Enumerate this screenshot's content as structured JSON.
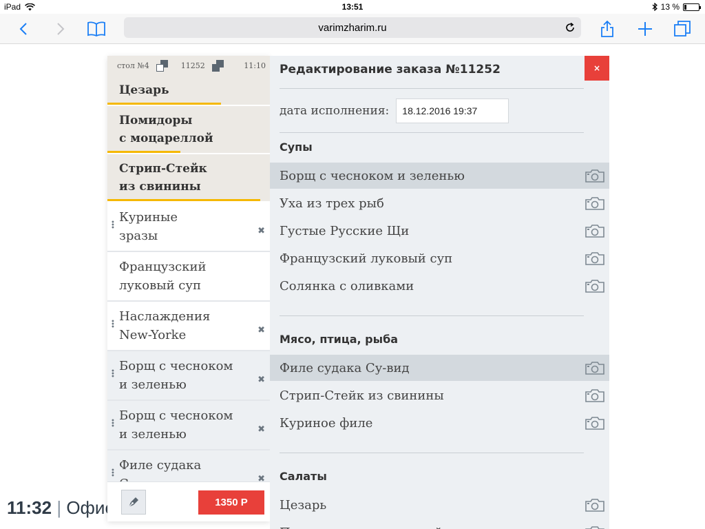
{
  "status_bar": {
    "device": "iPad",
    "time": "13:51",
    "battery_percent": "13 %",
    "battery_level": 0.13
  },
  "browser": {
    "url": "varimzharim.ru"
  },
  "background": {
    "clock": "11:32",
    "separator": "|",
    "partial_text": "Офис"
  },
  "order_panel": {
    "table": "стол №4",
    "order_number": "11252",
    "time": "11:10",
    "bold_dishes": [
      {
        "line1": "Цезарь",
        "line2": "",
        "progress": 0.7
      },
      {
        "line1": "Помидоры",
        "line2": "с моцареллой",
        "progress": 0.45
      },
      {
        "line1": "Стрип-Стейк",
        "line2": "из свинины",
        "progress": 0.94
      }
    ],
    "dishes": [
      {
        "line1": "Куриные",
        "line2": "зразы",
        "removable": true
      },
      {
        "line1": "Французский",
        "line2": "луковый суп",
        "removable": false
      },
      {
        "line1": "Наслаждения",
        "line2": "New-Yorke",
        "removable": true
      },
      {
        "line1": "Борщ с чесноком",
        "line2": "и зеленью",
        "removable": true
      },
      {
        "line1": "Борщ с чесноком",
        "line2": "и зеленью",
        "removable": true
      },
      {
        "line1": "Филе судака",
        "line2": "Су-вид",
        "removable": true
      }
    ],
    "total_button": "1350 Р"
  },
  "edit_panel": {
    "title": "Редактирование заказа №11252",
    "close_label": "×",
    "date_label": "дата исполнения:",
    "date_value": "18.12.2016 19:37",
    "categories": [
      {
        "title": "Супы",
        "items": [
          {
            "name": "Борщ с чесноком и зеленью",
            "active": true
          },
          {
            "name": "Уха из трех рыб",
            "active": false
          },
          {
            "name": "Густые Русские Щи",
            "active": false
          },
          {
            "name": "Французский луковый суп",
            "active": false
          },
          {
            "name": "Солянка с оливками",
            "active": false
          }
        ]
      },
      {
        "title": "Мясо, птица, рыба",
        "items": [
          {
            "name": "Филе судака Су-вид",
            "active": true
          },
          {
            "name": "Стрип-Стейк из свинины",
            "active": false
          },
          {
            "name": "Куриное филе",
            "active": false
          }
        ]
      },
      {
        "title": "Салаты",
        "items": [
          {
            "name": "Цезарь",
            "active": false
          },
          {
            "name": "Помидоры с моцареллой",
            "active": false
          }
        ]
      }
    ]
  },
  "colors": {
    "accent_red": "#e8403a",
    "progress_yellow": "#f5b800",
    "ios_blue": "#1a7ef5",
    "panel_grey": "#edf0f3"
  },
  "icons": [
    "wifi-icon",
    "bluetooth-icon",
    "battery-icon",
    "back-icon",
    "forward-icon",
    "bookmarks-icon",
    "reload-icon",
    "share-icon",
    "new-tab-icon",
    "tabs-icon",
    "table-icon",
    "order-icon",
    "grip-icon",
    "remove-icon",
    "pen-icon",
    "camera-icon",
    "close-icon"
  ]
}
